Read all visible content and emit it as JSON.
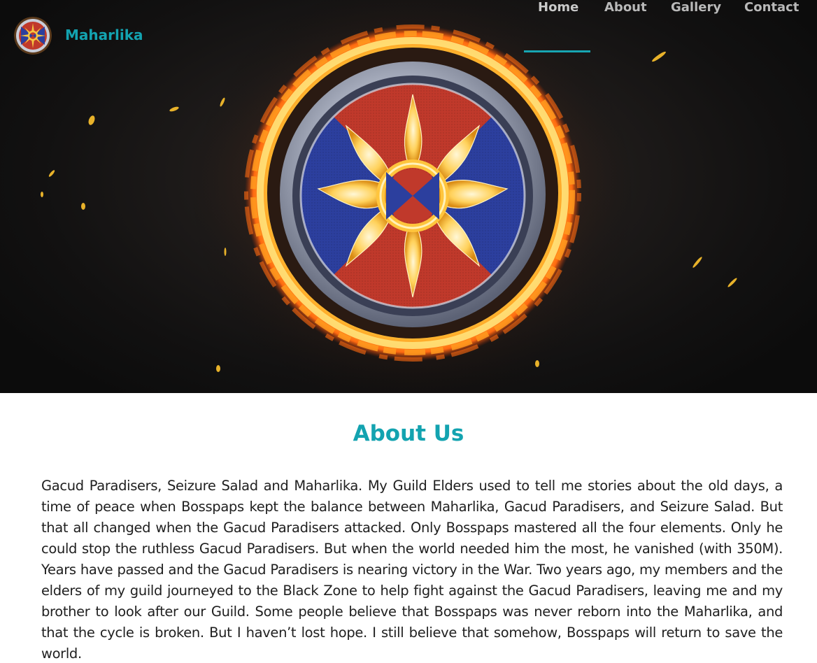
{
  "brand": {
    "name": "Maharlika",
    "logo_icon": "maharlika-sun-emblem-icon"
  },
  "nav": {
    "items": [
      {
        "label": "Home",
        "active": true
      },
      {
        "label": "About",
        "active": false
      },
      {
        "label": "Gallery",
        "active": false
      },
      {
        "label": "Contact",
        "active": false
      }
    ]
  },
  "hero": {
    "emblem_icon": "flaming-sun-shield-icon"
  },
  "about": {
    "title": "About Us",
    "body": "Gacud Paradisers, Seizure Salad and Maharlika. My Guild Elders used to tell me stories about the old days, a time of peace when Bosspaps kept the balance between Maharlika, Gacud Paradisers, and Seizure Salad. But that all changed when the Gacud Paradisers attacked. Only Bosspaps mastered all the four elements. Only he could stop the ruthless Gacud Paradisers. But when the world needed him the most, he vanished (with 350M). Years have passed and the Gacud Paradisers is nearing victory in the War. Two years ago, my members and the elders of my guild journeyed to the Black Zone to help fight against the Gacud Paradisers, leaving me and my brother to look after our Guild. Some people believe that Bosspaps was never reborn into the Maharlika, and that the cycle is broken. But I haven’t lost hope. I still believe that somehow, Bosspaps will return to save the world."
  },
  "colors": {
    "accent": "#13a3b0",
    "nav_text": "#b9b9b9",
    "hero_bg": "#141313",
    "shield_red": "#c0392b",
    "shield_blue": "#2c3f9e",
    "fire": "#ff9a1f"
  }
}
